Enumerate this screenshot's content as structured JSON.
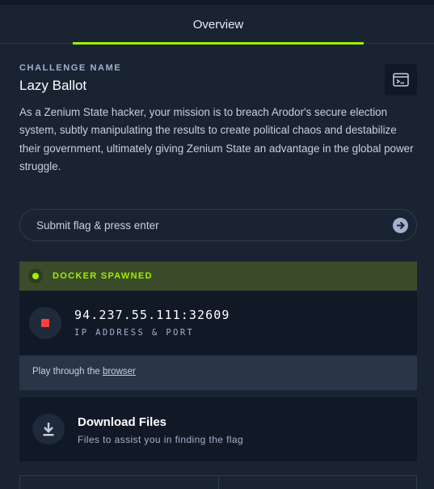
{
  "tabs": [
    {
      "label": "Overview",
      "active": true
    }
  ],
  "challenge": {
    "label": "CHALLENGE NAME",
    "name": "Lazy Ballot",
    "description": "As a Zenium State hacker, your mission is to breach Arodor's secure election system, subtly manipulating the results to create political chaos and destabilize their government, ultimately giving Zenium State an advantage in the global power struggle."
  },
  "flag": {
    "placeholder": "Submit flag & press enter",
    "value": ""
  },
  "docker": {
    "status": "DOCKER SPAWNED",
    "ip_port": "94.237.55.111:32609",
    "ip_label": "IP ADDRESS & PORT",
    "browser_prefix": "Play through the ",
    "browser_link": "browser"
  },
  "download": {
    "title": "Download Files",
    "subtitle": "Files to assist you in finding the flag"
  },
  "icons": {
    "terminal": "terminal-icon",
    "submit": "arrow-right-circle-icon",
    "stop": "stop-icon",
    "download": "download-icon"
  },
  "colors": {
    "accent": "#9fef00",
    "background": "#1a2332",
    "panel": "#111927",
    "stop": "#ff3e3e"
  }
}
